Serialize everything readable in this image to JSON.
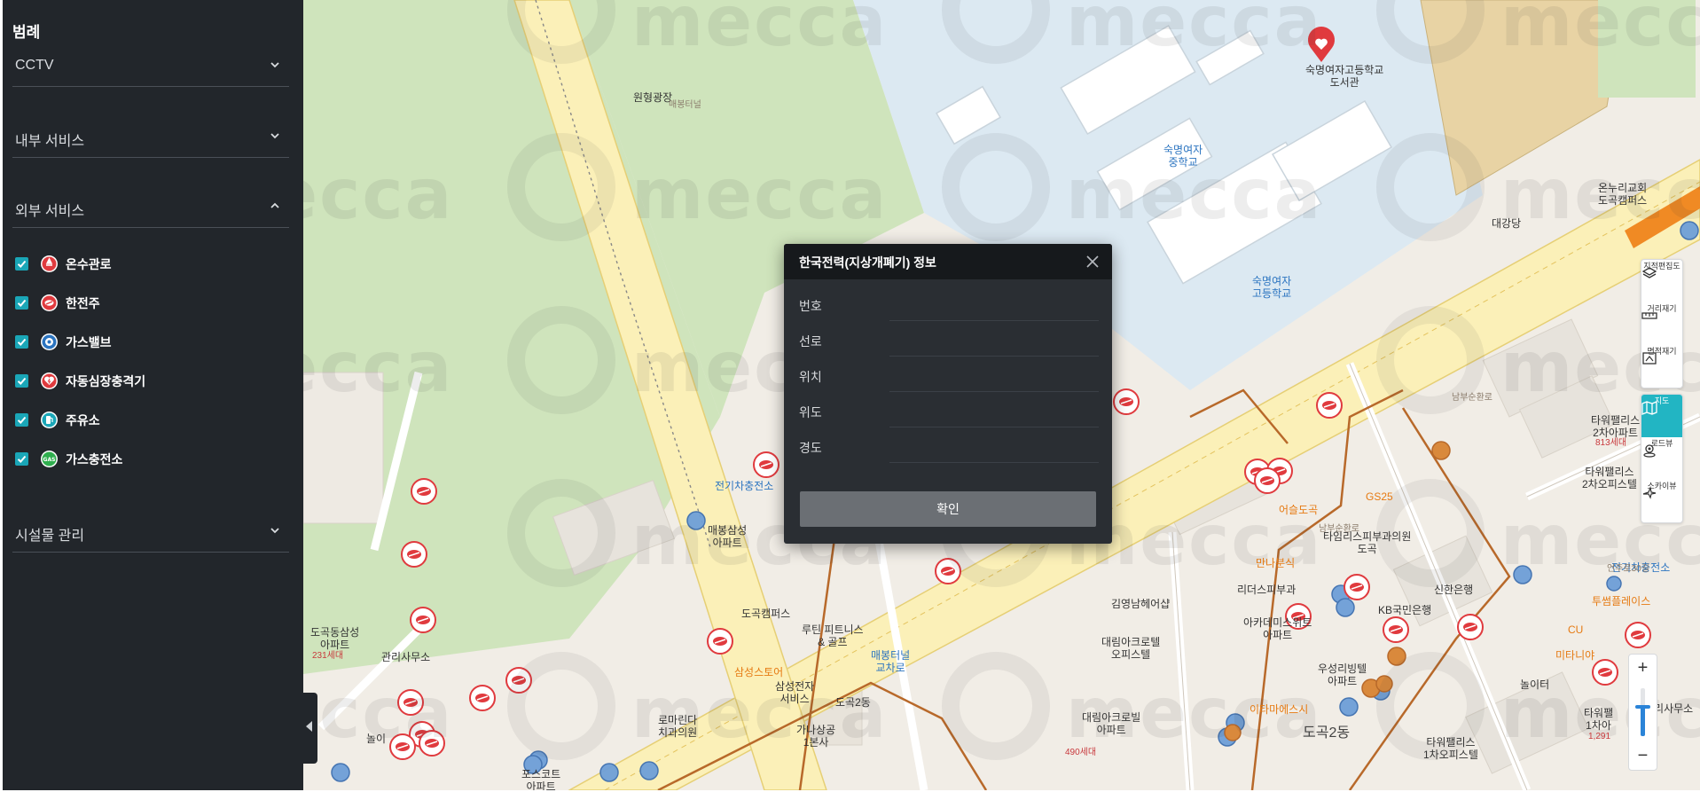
{
  "sidebar": {
    "title": "범례",
    "sections": [
      {
        "label": "CCTV",
        "expanded": false
      },
      {
        "label": "내부 서비스",
        "expanded": false
      },
      {
        "label": "외부 서비스",
        "expanded": true
      },
      {
        "label": "시설물 관리",
        "expanded": false
      }
    ],
    "layers": [
      {
        "label": "온수관로",
        "checked": true,
        "icon": "hot-water-pipe-icon",
        "color": "#e03a3e"
      },
      {
        "label": "한전주",
        "checked": true,
        "icon": "utility-pole-icon",
        "color": "#e03a3e"
      },
      {
        "label": "가스밸브",
        "checked": true,
        "icon": "gas-valve-icon",
        "color": "#2b74c0"
      },
      {
        "label": "자동심장충격기",
        "checked": true,
        "icon": "defibrillator-icon",
        "color": "#e03a3e"
      },
      {
        "label": "주유소",
        "checked": true,
        "icon": "gas-station-icon",
        "color": "#1aa6b7"
      },
      {
        "label": "가스충전소",
        "checked": true,
        "icon": "gas-charging-icon",
        "color": "#2fae4e",
        "icon_text": "GAS"
      }
    ]
  },
  "modal": {
    "title": "한국전력(지상개폐기) 정보",
    "fields": [
      {
        "label": "번호",
        "value": ""
      },
      {
        "label": "선로",
        "value": ""
      },
      {
        "label": "위치",
        "value": ""
      },
      {
        "label": "위도",
        "value": ""
      },
      {
        "label": "경도",
        "value": ""
      }
    ],
    "confirm_label": "확인"
  },
  "toolbar": {
    "items": [
      {
        "label": "지적편집도",
        "icon": "layers-icon",
        "active": false
      },
      {
        "label": "거리재기",
        "icon": "ruler-icon",
        "active": false
      },
      {
        "label": "면적재기",
        "icon": "area-icon",
        "active": false
      },
      {
        "label": "지도",
        "icon": "map-icon",
        "active": true
      },
      {
        "label": "로드뷰",
        "icon": "roadview-icon",
        "active": false
      },
      {
        "label": "스카이뷰",
        "icon": "skyview-icon",
        "active": false
      }
    ]
  },
  "zoom": {
    "in": "+",
    "out": "−",
    "level": 0.62
  },
  "map": {
    "watermark": "mecca",
    "labels": [
      {
        "text": "원형광장",
        "cls": "dark"
      },
      {
        "text": "매봉터널",
        "cls": "tiny"
      },
      {
        "text": "숙명여자고등학교\n도서관",
        "cls": "dark"
      },
      {
        "text": "숙명여자\n중학교",
        "cls": "blue"
      },
      {
        "text": "숙명여자\n고등학교",
        "cls": "blue"
      },
      {
        "text": "대강당",
        "cls": "dark"
      },
      {
        "text": "온누리교회\n도곡캠퍼스",
        "cls": "dark"
      },
      {
        "text": "타워팰리스\n2차아파트",
        "cls": "dark"
      },
      {
        "text": "813세대",
        "cls": "red"
      },
      {
        "text": "타워팰리스\n2차오피스텔",
        "cls": "dark"
      },
      {
        "text": "전기차충전소",
        "cls": "blue"
      },
      {
        "text": "매봉삼성\n아파트",
        "cls": "dark"
      },
      {
        "text": "도곡캠퍼스",
        "cls": "dark"
      },
      {
        "text": "루틴 피트니스\n& 골프",
        "cls": "dark"
      },
      {
        "text": "삼성스토어",
        "cls": "orange"
      },
      {
        "text": "삼성전자\n서비스",
        "cls": "dark"
      },
      {
        "text": "로마린다\n치과의원",
        "cls": "dark"
      },
      {
        "text": "매봉터널\n교차로",
        "cls": "blue"
      },
      {
        "text": "도곡2동",
        "cls": "dark"
      },
      {
        "text": "GS25",
        "cls": "orange"
      },
      {
        "text": "어슬도곡",
        "cls": "orange"
      },
      {
        "text": "타임리스피부과의원\n도곡",
        "cls": "dark"
      },
      {
        "text": "만나분식",
        "cls": "orange"
      },
      {
        "text": "리더스피부과",
        "cls": "dark"
      },
      {
        "text": "아카데미스위트\n아파트",
        "cls": "dark"
      },
      {
        "text": "김영남헤어샵",
        "cls": "dark"
      },
      {
        "text": "대림아크로텔\n오피스텔",
        "cls": "dark"
      },
      {
        "text": "KB국민은행",
        "cls": "dark"
      },
      {
        "text": "신한은행",
        "cls": "dark"
      },
      {
        "text": "우성리빙텔\n아파트",
        "cls": "dark"
      },
      {
        "text": "이타마에스시",
        "cls": "orange"
      },
      {
        "text": "타워팰리스\n1차오피스텔",
        "cls": "dark"
      },
      {
        "text": "도곡2동",
        "cls": "district"
      },
      {
        "text": "전기차충전소",
        "cls": "blue"
      },
      {
        "text": "투썸플레이스",
        "cls": "orange"
      },
      {
        "text": "CU",
        "cls": "orange"
      },
      {
        "text": "미타니야",
        "cls": "orange"
      },
      {
        "text": "놀이터",
        "cls": "dark"
      },
      {
        "text": "타워팰\n1차아",
        "cls": "dark"
      },
      {
        "text": "1,291",
        "cls": "red"
      },
      {
        "text": "관리사무소",
        "cls": "dark"
      },
      {
        "text": "도곡동삼성\n아파트",
        "cls": "dark"
      },
      {
        "text": "231세대",
        "cls": "red"
      },
      {
        "text": "관리사무소",
        "cls": "dark"
      },
      {
        "text": "가나상공\n1본사",
        "cls": "dark"
      },
      {
        "text": "대림아크로빌\n아파트",
        "cls": "dark"
      },
      {
        "text": "490세대",
        "cls": "red"
      },
      {
        "text": "포스코트\n아파트",
        "cls": "dark"
      },
      {
        "text": "언주로30길",
        "cls": "tiny"
      },
      {
        "text": "남부순환로",
        "cls": "tiny"
      },
      {
        "text": "남부순환로",
        "cls": "tiny"
      },
      {
        "text": "남부순환로",
        "cls": "tiny"
      },
      {
        "text": "놀이",
        "cls": "dark"
      }
    ]
  }
}
